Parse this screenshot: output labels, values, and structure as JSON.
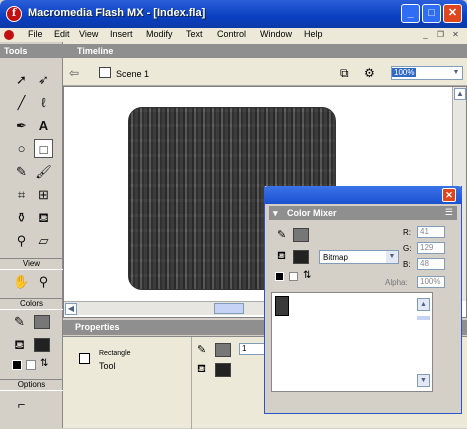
{
  "window": {
    "title": "Macromedia Flash MX - [Index.fla]",
    "logo_letter": "f",
    "min": "_",
    "max": "□",
    "close": "✕"
  },
  "menu": [
    "File",
    "Edit",
    "View",
    "Insert",
    "Modify",
    "Text",
    "Control",
    "Window",
    "Help"
  ],
  "mdi": {
    "min": "_",
    "restore": "❐",
    "close": "✕"
  },
  "tools": {
    "header": "Tools",
    "view_label": "View",
    "colors_label": "Colors",
    "options_label": "Options"
  },
  "timeline": {
    "label": "Timeline"
  },
  "scene": {
    "name": "Scene 1",
    "zoom": "100%"
  },
  "properties": {
    "header": "Properties",
    "tool_line1": "Rectangle",
    "tool_line2": "Tool",
    "stroke_width": "1"
  },
  "mixer": {
    "window_title": "",
    "panel_title": "Color Mixer",
    "fill_type": "Bitmap",
    "r_label": "R:",
    "r_value": "41",
    "g_label": "G:",
    "g_value": "129",
    "b_label": "B:",
    "b_value": "48",
    "alpha_label": "Alpha:",
    "alpha_value": "100%"
  },
  "colors": {
    "accent": "#0a3fc0",
    "stage": "#ffffff",
    "panel": "#d4d0c8"
  }
}
